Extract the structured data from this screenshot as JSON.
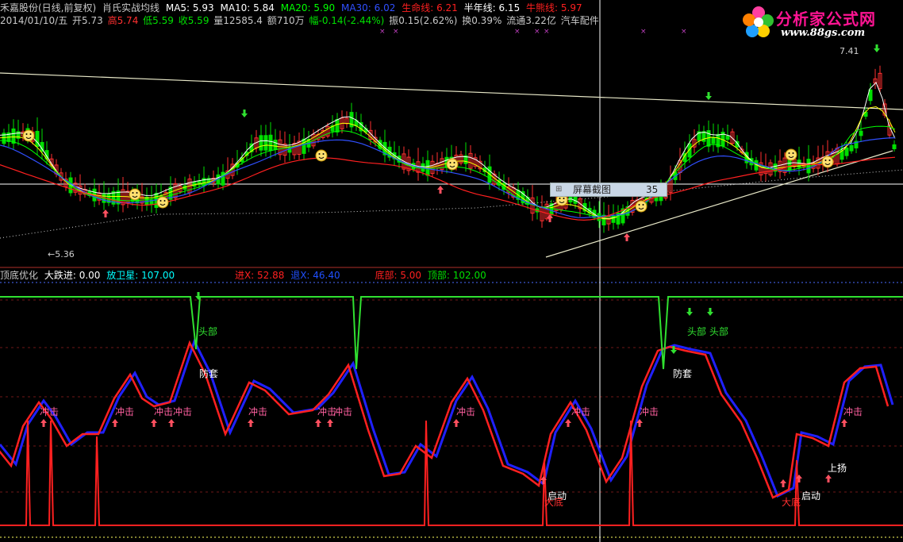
{
  "header": {
    "stock": "禾嘉股份(日线,前复权)",
    "indicator": "肖氏实战均线",
    "ma5": "MA5: 5.93",
    "ma10": "MA10: 5.84",
    "ma20": "MA20: 5.90",
    "ma30": "MA30: 6.02",
    "life_line": "生命线: 6.21",
    "half_year": "半年线: 6.15",
    "bull_bear": "牛熊线: 5.97"
  },
  "info": {
    "date": "2014/01/10/五",
    "open": "开5.73",
    "high": "高5.74",
    "low": "低5.59",
    "close": "收5.59",
    "volume": "量12585.4",
    "amount": "额710万",
    "change": "幅-0.14(-2.44%)",
    "amplitude": "振0.15(2.62%)",
    "turnover": "换0.39%",
    "float": "流通3.22亿",
    "sector": "汽车配件"
  },
  "price_labels": {
    "high": "7.41",
    "low": "←5.36"
  },
  "tooltip": {
    "label": "屏幕截图",
    "value": "35"
  },
  "lower": {
    "name": "顶底优化",
    "dadie": "大跌进: 0.00",
    "fangwei": "放卫星: 107.00",
    "jinx": "进X: 52.88",
    "tuix": "退X: 46.40",
    "dibu": "底部: 5.00",
    "dingbu": "顶部: 102.00"
  },
  "signals": {
    "top": "头部",
    "guard": "防套",
    "impact": "冲击",
    "start": "启动",
    "rise": "上扬",
    "big": "大底"
  },
  "logo": {
    "title": "分析家公式网",
    "url": "www.88gs.com"
  },
  "colors": {
    "background": "#000000",
    "up": "#ff3030",
    "down": "#00e000",
    "ma5": "#ffffff",
    "ma10": "#ffff00",
    "ma20": "#00ff00",
    "ma30": "#3050ff",
    "life": "#ff2020",
    "lower_red": "#ff2020",
    "lower_blue": "#2020ff"
  }
}
